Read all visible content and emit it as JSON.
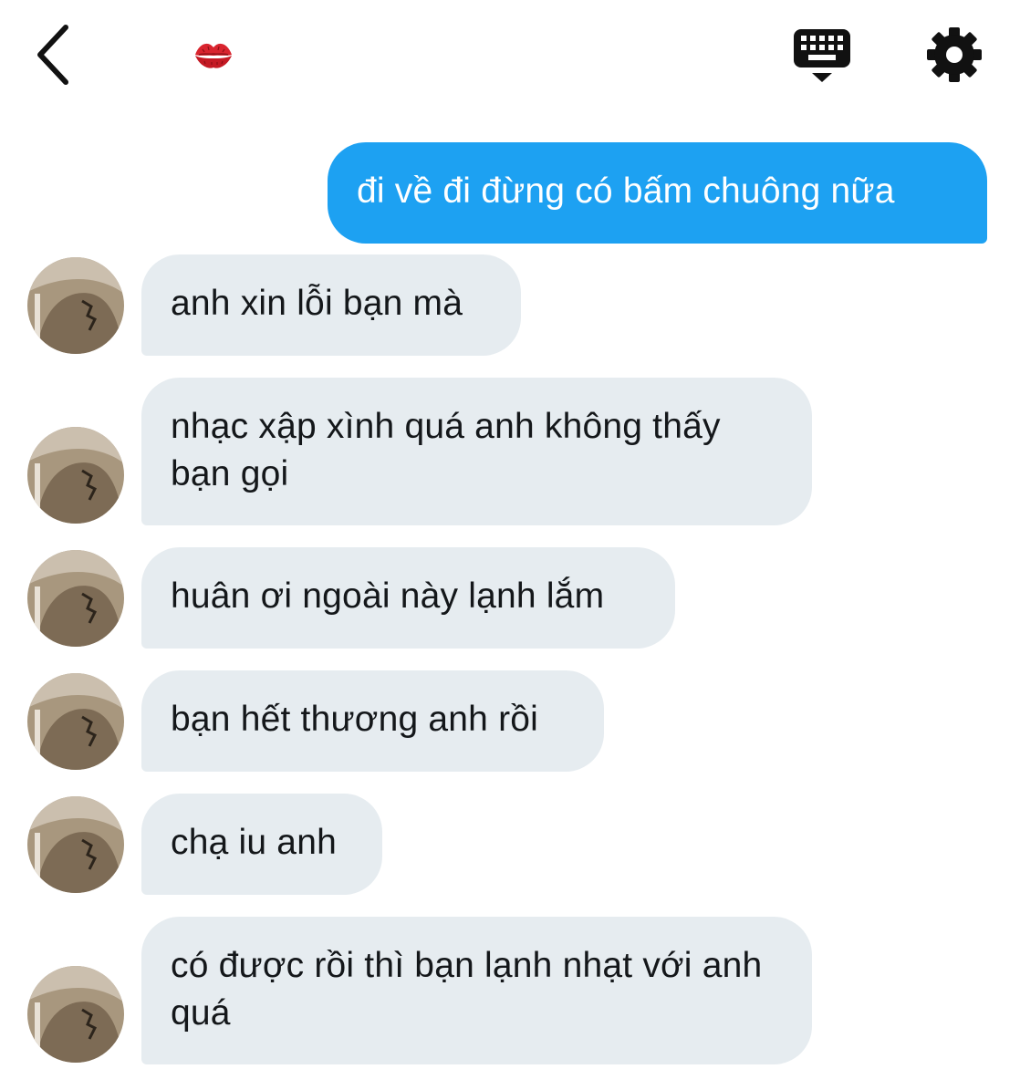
{
  "header": {
    "back_icon": "chevron-left-icon",
    "contact_emoji": "💋",
    "keyboard_icon": "keyboard-icon",
    "settings_icon": "gear-icon"
  },
  "colors": {
    "sent_bubble": "#1da1f2",
    "received_bubble": "#e6ecf0",
    "text": "#14171a"
  },
  "messages": [
    {
      "from": "me",
      "text": "đi về đi đừng có bấm chuông nữa"
    },
    {
      "from": "them",
      "text": "anh xin lỗi bạn mà"
    },
    {
      "from": "them",
      "text": "nhạc xập xình quá anh không thấy bạn gọi"
    },
    {
      "from": "them",
      "text": "huân ơi ngoài này lạnh lắm"
    },
    {
      "from": "them",
      "text": "bạn hết thương anh rồi"
    },
    {
      "from": "them",
      "text": "chạ iu anh"
    },
    {
      "from": "them",
      "text": "có được rồi thì bạn lạnh nhạt với anh quá"
    }
  ]
}
